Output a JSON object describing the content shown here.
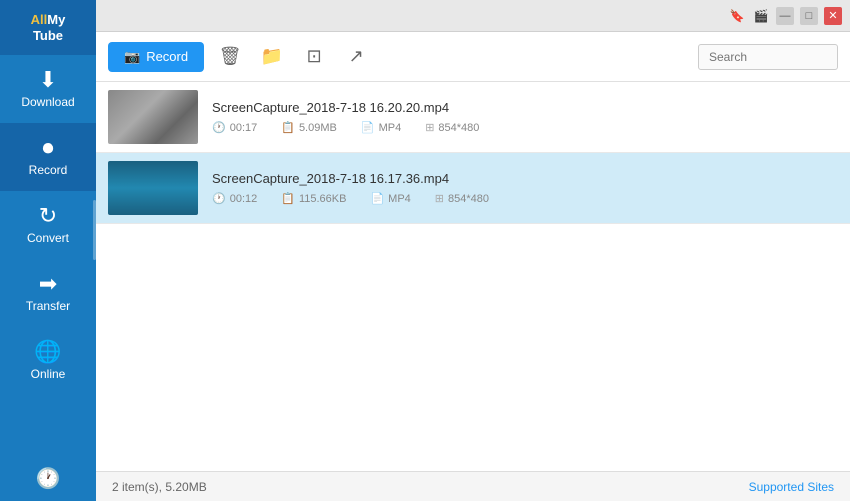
{
  "app": {
    "title": "AllMyTube",
    "logo_line1": "All",
    "logo_line2": "My",
    "logo_line3": "Tube"
  },
  "titlebar": {
    "icons": [
      "🔖",
      "🎬",
      "—",
      "□",
      "✕"
    ]
  },
  "toolbar": {
    "record_label": "Record",
    "search_placeholder": "Search"
  },
  "nav": {
    "items": [
      {
        "id": "download",
        "label": "Download",
        "icon": "⬇"
      },
      {
        "id": "record",
        "label": "Record",
        "icon": "⏺"
      },
      {
        "id": "convert",
        "label": "Convert",
        "icon": "↻"
      },
      {
        "id": "transfer",
        "label": "Transfer",
        "icon": "➡"
      },
      {
        "id": "online",
        "label": "Online",
        "icon": "🌐"
      }
    ],
    "active": "record"
  },
  "files": [
    {
      "name": "ScreenCapture_2018-7-18 16.20.20.mp4",
      "duration": "00:17",
      "size": "5.09MB",
      "format": "MP4",
      "resolution": "854*480",
      "thumb_type": "anime",
      "selected": false
    },
    {
      "name": "ScreenCapture_2018-7-18 16.17.36.mp4",
      "duration": "00:12",
      "size": "115.66KB",
      "format": "MP4",
      "resolution": "854*480",
      "thumb_type": "blue",
      "selected": true
    }
  ],
  "statusbar": {
    "info": "2 item(s), 5.20MB",
    "supported_sites_label": "Supported Sites"
  }
}
